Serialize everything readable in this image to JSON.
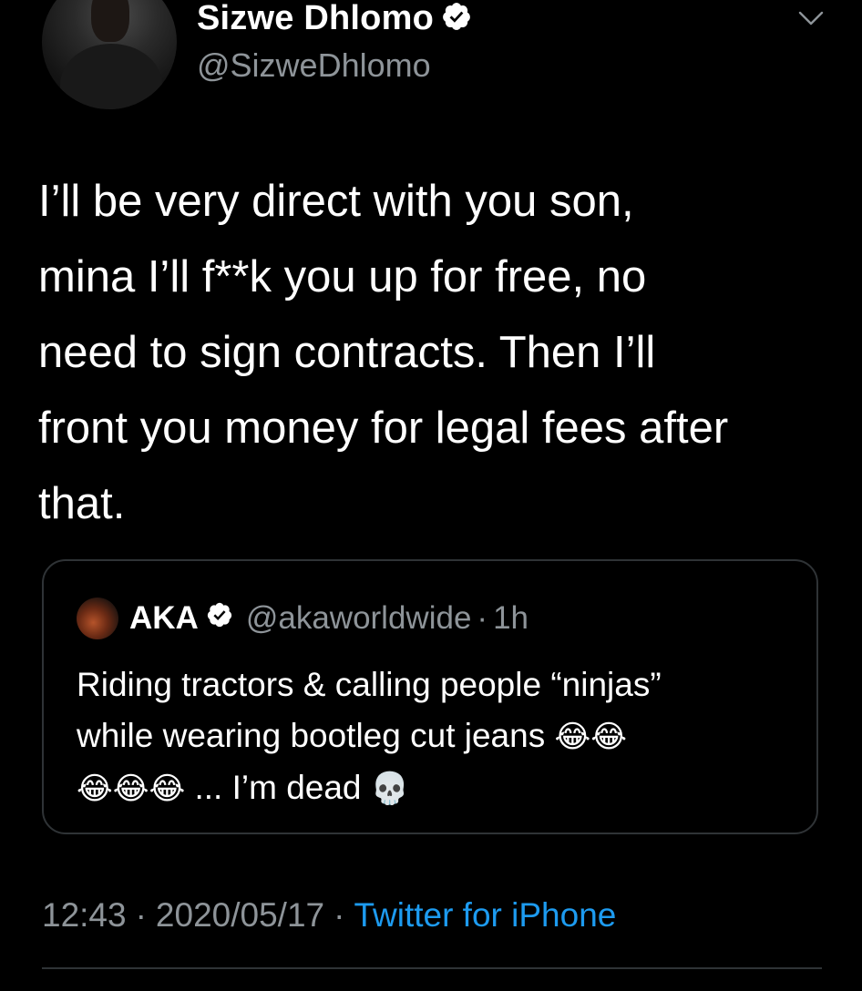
{
  "author": {
    "display_name": "Sizwe Dhlomo",
    "handle": "@SizweDhlomo",
    "verified": true,
    "avatar_icon": "user-avatar",
    "menu_icon": "chevron-down-icon"
  },
  "tweet": {
    "text": "I’ll be very direct with you son,\nmina I’ll f**k you up for free, no\nneed to sign contracts. Then I’ll\nfront you money for legal fees after\nthat."
  },
  "quoted_tweet": {
    "display_name": "AKA",
    "handle": "@akaworldwide",
    "dot": "·",
    "time": "1h",
    "verified": true,
    "text_line1": "Riding tractors & calling people “ninjas”",
    "text_line2": "while wearing bootleg cut jeans",
    "emoji_line2": "😂😂",
    "text_line3_emoji": "😂😂😂",
    "text_line3": " ... I’m dead ",
    "emoji_line3_end": "💀"
  },
  "meta": {
    "time": "12:43",
    "sep1": "·",
    "date": "2020/05/17",
    "sep2": "·",
    "client": "Twitter for iPhone"
  },
  "colors": {
    "background": "#000000",
    "text": "#ffffff",
    "secondary_text": "#8e9499",
    "link": "#1d9bf0",
    "border": "#2f3336"
  }
}
